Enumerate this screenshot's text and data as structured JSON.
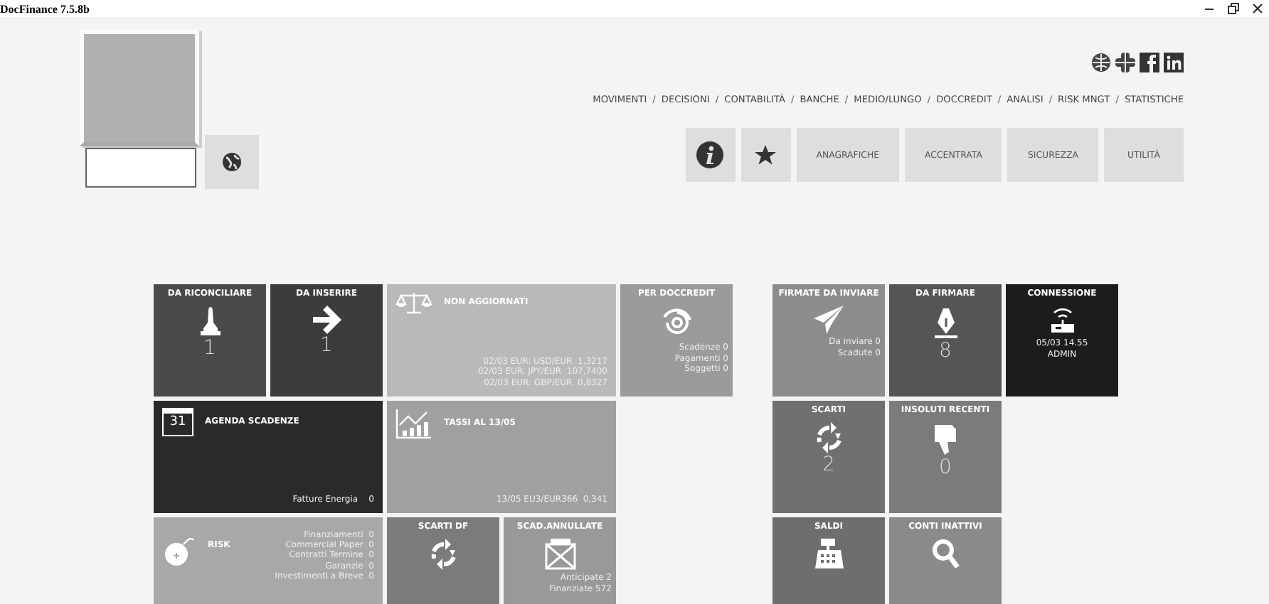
{
  "window": {
    "title": "DocFinance 7.5.8b"
  },
  "nav": {
    "separator": "/",
    "items": [
      "MOVIMENTI",
      "DECISIONI",
      "CONTABILITÀ",
      "BANCHE",
      "MEDIO/LUNGO",
      "DOCCREDIT",
      "ANALISI",
      "RISK MNGT",
      "STATISTICHE"
    ]
  },
  "toolbar": {
    "buttons": [
      "ANAGRAFICHE",
      "ACCENTRATA",
      "SICUREZZA",
      "UTILITÀ"
    ]
  },
  "tile_groups": [
    {
      "rows": [
        {
          "tiles": [
            {
              "kind": "count",
              "title": "DA RICONCILIARE",
              "count": "1",
              "color": "#4a4a4a"
            },
            {
              "kind": "count",
              "title": "DA INSERIRE",
              "count": "1",
              "color": "#3c3c3c"
            },
            {
              "kind": "wide",
              "title": "NON AGGIORNATI",
              "lines": [
                "02/03 EUR: USD/EUR  1,3217",
                "02/03 EUR: JPY/EUR  107,7400",
                "02/03 EUR: GBP/EUR  0,8327"
              ],
              "color": "#b9b9b9"
            },
            {
              "kind": "lines",
              "title": "PER DOCCREDIT",
              "lines": [
                "Scadenze 0",
                "Pagamenti 0",
                "Soggetti 0"
              ],
              "color": "#9b9b9b"
            }
          ]
        },
        {
          "tiles": [
            {
              "kind": "wide",
              "title": "AGENDA SCADENZE",
              "icon_text": "31",
              "lines": [
                "Fatture Energia    0"
              ],
              "color": "#2a2a2a"
            },
            {
              "kind": "wide",
              "title": "TASSI AL 13/05",
              "lines": [
                "13/05 EU3/EUR366  0,341"
              ],
              "color": "#a0a0a0"
            }
          ]
        },
        {
          "tiles": [
            {
              "kind": "list",
              "title": "RISK",
              "lines": [
                "Finanziamenti  0",
                "Commercial Paper  0",
                "Contratti Termine  0",
                "Garanzie  0",
                "Investimenti a Breve  0"
              ],
              "color": "#a8a8a8"
            },
            {
              "kind": "count",
              "title": "SCARTI DF",
              "color": "#7b7b7b"
            },
            {
              "kind": "lines",
              "title": "SCAD.ANNULLATE",
              "lines": [
                "Anticipate 2",
                "Finanziate 572"
              ],
              "color": "#999999"
            }
          ]
        }
      ]
    },
    {
      "rows": [
        {
          "tiles": [
            {
              "kind": "lines",
              "title": "FIRMATE DA INVIARE",
              "lines": [
                "Da inviare 0",
                "Scadute 0"
              ],
              "color": "#8c8c8c"
            },
            {
              "kind": "count",
              "title": "DA FIRMARE",
              "count": "8",
              "color": "#555555"
            },
            {
              "kind": "center",
              "title": "CONNESSIONE",
              "lines": [
                "05/03 14.55",
                "ADMIN"
              ],
              "color": "#1c1c1c"
            }
          ]
        },
        {
          "tiles": [
            {
              "kind": "count",
              "title": "SCARTI",
              "count": "2",
              "color": "#707070"
            },
            {
              "kind": "count",
              "title": "INSOLUTI RECENTI",
              "count": "0",
              "color": "#7b7b7b"
            }
          ]
        },
        {
          "tiles": [
            {
              "kind": "count",
              "title": "SALDI",
              "color": "#6e6e6e"
            },
            {
              "kind": "count",
              "title": "CONTI INATTIVI",
              "color": "#8a8a8a"
            }
          ]
        }
      ]
    }
  ]
}
